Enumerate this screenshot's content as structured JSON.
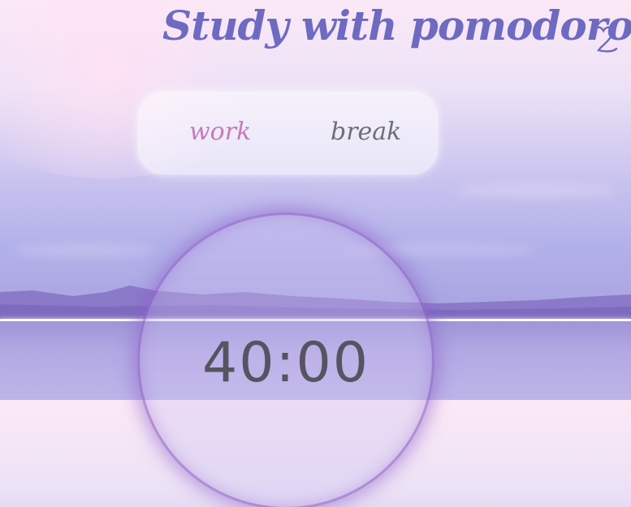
{
  "header": {
    "title": "Study with pomodoro",
    "heart_icon": "heart-icon"
  },
  "mode_tabs": {
    "work_label": "work",
    "break_label": "break",
    "active": "work"
  },
  "timer": {
    "display": "40:00"
  },
  "colors": {
    "title": "#6e6ac2",
    "active_tab": "#c77ab9",
    "inactive_tab": "#6b6f7a",
    "timer_text": "#555460",
    "circle_glow": "#8c5fc8"
  }
}
